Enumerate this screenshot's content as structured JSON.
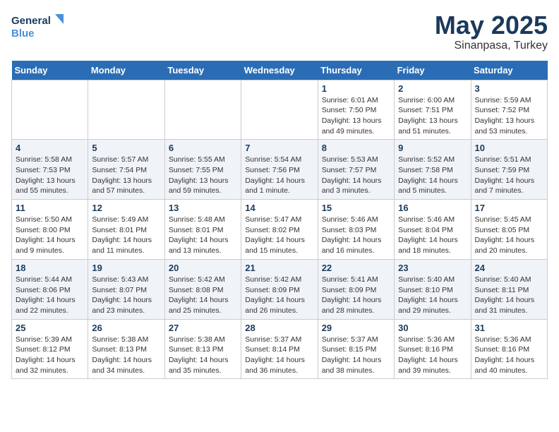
{
  "header": {
    "logo_line1": "General",
    "logo_line2": "Blue",
    "month_title": "May 2025",
    "location": "Sinanpasa, Turkey"
  },
  "weekdays": [
    "Sunday",
    "Monday",
    "Tuesday",
    "Wednesday",
    "Thursday",
    "Friday",
    "Saturday"
  ],
  "weeks": [
    [
      {
        "day": "",
        "detail": ""
      },
      {
        "day": "",
        "detail": ""
      },
      {
        "day": "",
        "detail": ""
      },
      {
        "day": "",
        "detail": ""
      },
      {
        "day": "1",
        "detail": "Sunrise: 6:01 AM\nSunset: 7:50 PM\nDaylight: 13 hours\nand 49 minutes."
      },
      {
        "day": "2",
        "detail": "Sunrise: 6:00 AM\nSunset: 7:51 PM\nDaylight: 13 hours\nand 51 minutes."
      },
      {
        "day": "3",
        "detail": "Sunrise: 5:59 AM\nSunset: 7:52 PM\nDaylight: 13 hours\nand 53 minutes."
      }
    ],
    [
      {
        "day": "4",
        "detail": "Sunrise: 5:58 AM\nSunset: 7:53 PM\nDaylight: 13 hours\nand 55 minutes."
      },
      {
        "day": "5",
        "detail": "Sunrise: 5:57 AM\nSunset: 7:54 PM\nDaylight: 13 hours\nand 57 minutes."
      },
      {
        "day": "6",
        "detail": "Sunrise: 5:55 AM\nSunset: 7:55 PM\nDaylight: 13 hours\nand 59 minutes."
      },
      {
        "day": "7",
        "detail": "Sunrise: 5:54 AM\nSunset: 7:56 PM\nDaylight: 14 hours\nand 1 minute."
      },
      {
        "day": "8",
        "detail": "Sunrise: 5:53 AM\nSunset: 7:57 PM\nDaylight: 14 hours\nand 3 minutes."
      },
      {
        "day": "9",
        "detail": "Sunrise: 5:52 AM\nSunset: 7:58 PM\nDaylight: 14 hours\nand 5 minutes."
      },
      {
        "day": "10",
        "detail": "Sunrise: 5:51 AM\nSunset: 7:59 PM\nDaylight: 14 hours\nand 7 minutes."
      }
    ],
    [
      {
        "day": "11",
        "detail": "Sunrise: 5:50 AM\nSunset: 8:00 PM\nDaylight: 14 hours\nand 9 minutes."
      },
      {
        "day": "12",
        "detail": "Sunrise: 5:49 AM\nSunset: 8:01 PM\nDaylight: 14 hours\nand 11 minutes."
      },
      {
        "day": "13",
        "detail": "Sunrise: 5:48 AM\nSunset: 8:01 PM\nDaylight: 14 hours\nand 13 minutes."
      },
      {
        "day": "14",
        "detail": "Sunrise: 5:47 AM\nSunset: 8:02 PM\nDaylight: 14 hours\nand 15 minutes."
      },
      {
        "day": "15",
        "detail": "Sunrise: 5:46 AM\nSunset: 8:03 PM\nDaylight: 14 hours\nand 16 minutes."
      },
      {
        "day": "16",
        "detail": "Sunrise: 5:46 AM\nSunset: 8:04 PM\nDaylight: 14 hours\nand 18 minutes."
      },
      {
        "day": "17",
        "detail": "Sunrise: 5:45 AM\nSunset: 8:05 PM\nDaylight: 14 hours\nand 20 minutes."
      }
    ],
    [
      {
        "day": "18",
        "detail": "Sunrise: 5:44 AM\nSunset: 8:06 PM\nDaylight: 14 hours\nand 22 minutes."
      },
      {
        "day": "19",
        "detail": "Sunrise: 5:43 AM\nSunset: 8:07 PM\nDaylight: 14 hours\nand 23 minutes."
      },
      {
        "day": "20",
        "detail": "Sunrise: 5:42 AM\nSunset: 8:08 PM\nDaylight: 14 hours\nand 25 minutes."
      },
      {
        "day": "21",
        "detail": "Sunrise: 5:42 AM\nSunset: 8:09 PM\nDaylight: 14 hours\nand 26 minutes."
      },
      {
        "day": "22",
        "detail": "Sunrise: 5:41 AM\nSunset: 8:09 PM\nDaylight: 14 hours\nand 28 minutes."
      },
      {
        "day": "23",
        "detail": "Sunrise: 5:40 AM\nSunset: 8:10 PM\nDaylight: 14 hours\nand 29 minutes."
      },
      {
        "day": "24",
        "detail": "Sunrise: 5:40 AM\nSunset: 8:11 PM\nDaylight: 14 hours\nand 31 minutes."
      }
    ],
    [
      {
        "day": "25",
        "detail": "Sunrise: 5:39 AM\nSunset: 8:12 PM\nDaylight: 14 hours\nand 32 minutes."
      },
      {
        "day": "26",
        "detail": "Sunrise: 5:38 AM\nSunset: 8:13 PM\nDaylight: 14 hours\nand 34 minutes."
      },
      {
        "day": "27",
        "detail": "Sunrise: 5:38 AM\nSunset: 8:13 PM\nDaylight: 14 hours\nand 35 minutes."
      },
      {
        "day": "28",
        "detail": "Sunrise: 5:37 AM\nSunset: 8:14 PM\nDaylight: 14 hours\nand 36 minutes."
      },
      {
        "day": "29",
        "detail": "Sunrise: 5:37 AM\nSunset: 8:15 PM\nDaylight: 14 hours\nand 38 minutes."
      },
      {
        "day": "30",
        "detail": "Sunrise: 5:36 AM\nSunset: 8:16 PM\nDaylight: 14 hours\nand 39 minutes."
      },
      {
        "day": "31",
        "detail": "Sunrise: 5:36 AM\nSunset: 8:16 PM\nDaylight: 14 hours\nand 40 minutes."
      }
    ]
  ]
}
